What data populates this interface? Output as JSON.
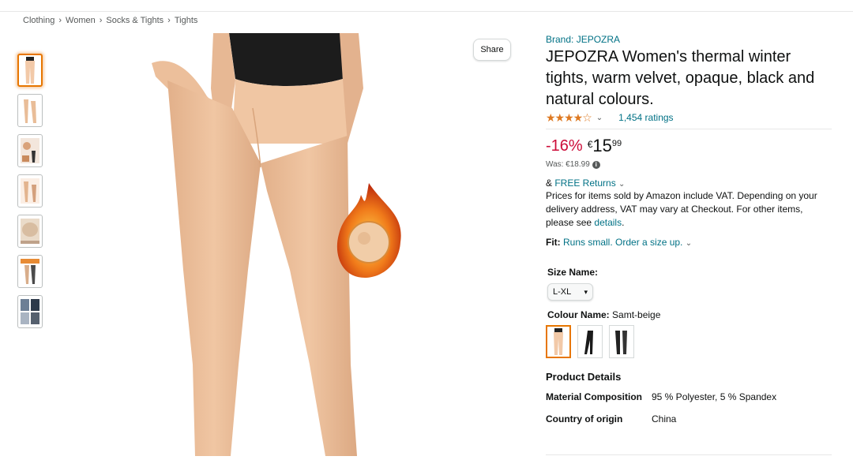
{
  "breadcrumb": [
    "Clothing",
    "Women",
    "Socks & Tights",
    "Tights"
  ],
  "breadcrumb_sep": "›",
  "share_label": "Share",
  "brand": "Brand: JEPOZRA",
  "title": "JEPOZRA Women's thermal winter tights, warm velvet, opaque, black and natural colours.",
  "rating": {
    "stars": 3.5,
    "stars_glyph": "★★★★☆",
    "ratings_count": "1,454 ratings"
  },
  "price": {
    "discount": "-16%",
    "currency": "€",
    "whole": "15",
    "fraction": "99",
    "was": "Was: €18.99"
  },
  "returns": {
    "prefix": "& ",
    "link": "FREE Returns"
  },
  "vat": {
    "text": "Prices for items sold by Amazon include VAT. Depending on your delivery address, VAT may vary at Checkout. For other items, please see ",
    "link": "details",
    "end": "."
  },
  "fit": {
    "label": "Fit:",
    "value": "Runs small. Order a size up."
  },
  "size": {
    "label": "Size Name:",
    "selected": "L-XL"
  },
  "colour": {
    "label": "Colour Name:",
    "value": "Samt-beige"
  },
  "product_details": {
    "title": "Product Details",
    "rows": [
      {
        "key": "Material Composition",
        "value": "95 % Polyester, 5 % Spandex"
      },
      {
        "key": "Country of origin",
        "value": "China"
      }
    ]
  },
  "colors": {
    "link": "#007185",
    "discount": "#cc0c39",
    "star": "#de7921",
    "selected_border": "#e77600",
    "skin": "#f2c9a8"
  }
}
